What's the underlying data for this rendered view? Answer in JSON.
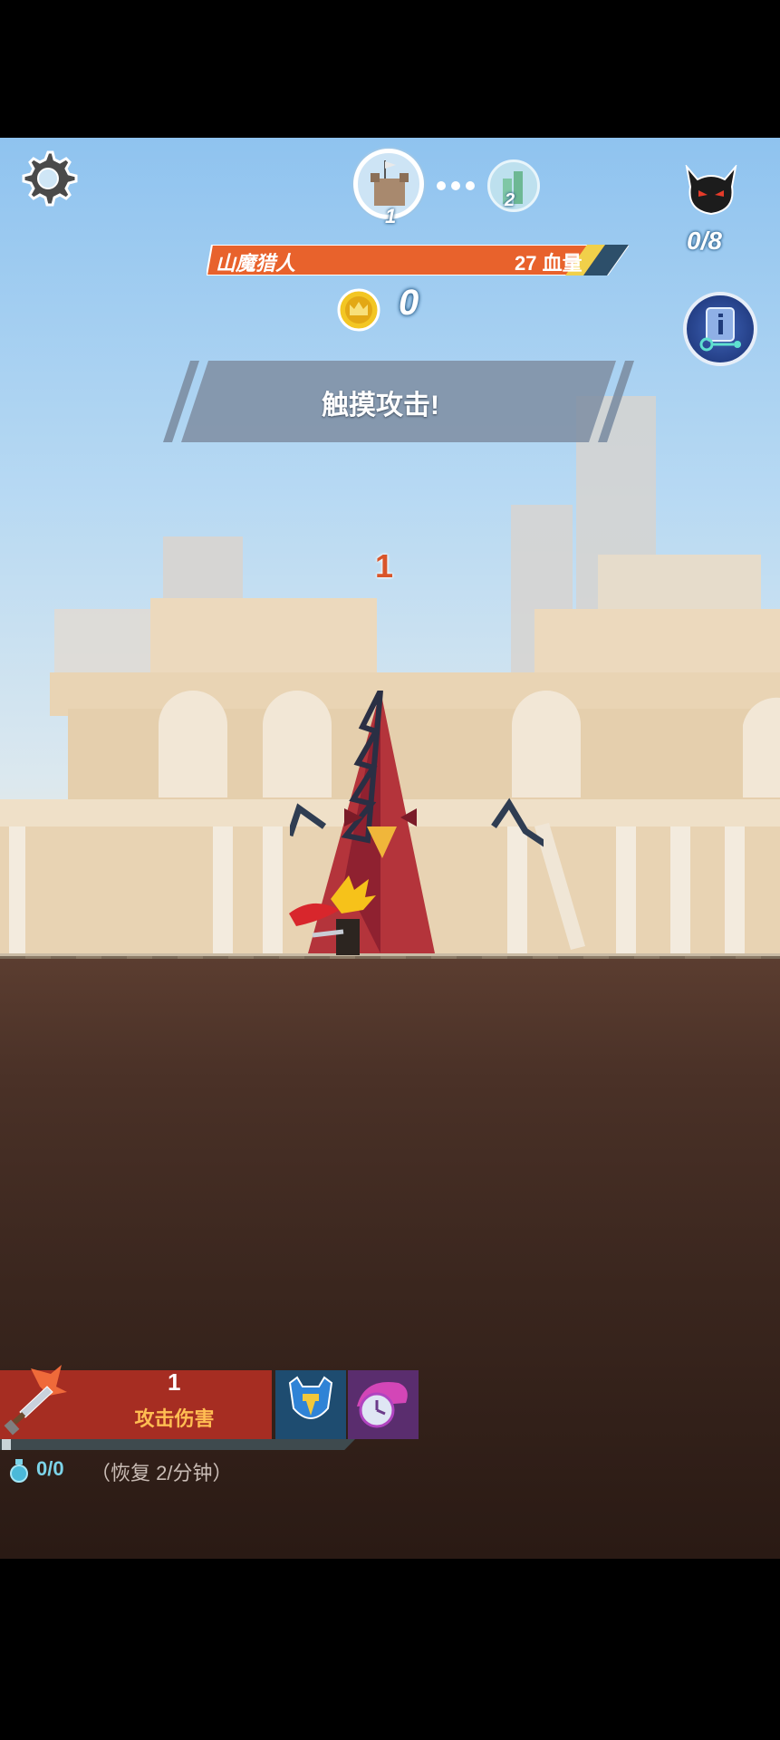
{
  "hud": {
    "stage_current": "1",
    "stage_next": "2",
    "boss_name": "山魔猎人",
    "boss_hp_value": "27",
    "boss_hp_label": "血量",
    "boss_hp_text": "27 血量",
    "coins": "0",
    "kills": "0/8"
  },
  "banner": {
    "text": "触摸攻击!"
  },
  "combat": {
    "damage_number": "1"
  },
  "skill_bar": {
    "attack_level": "1",
    "attack_label": "攻击伤害"
  },
  "mana": {
    "value": "0/0",
    "regen": "（恢复 2/分钟）"
  },
  "colors": {
    "boss_bar": "#e8622c",
    "skill_panel": "#a62d22",
    "skill_label": "#ffbd52",
    "mana_text": "#7cd3e8",
    "sky": "#8fc3ef",
    "ground": "#4a3127"
  },
  "icons": {
    "settings": "gear-icon",
    "stage": "castle-icon",
    "kills": "demon-icon",
    "info": "info-icon",
    "coin": "crown-coin-icon",
    "attack": "sword-icon",
    "helmet": "helmet-icon",
    "time": "clock-icon",
    "mana": "potion-icon"
  }
}
